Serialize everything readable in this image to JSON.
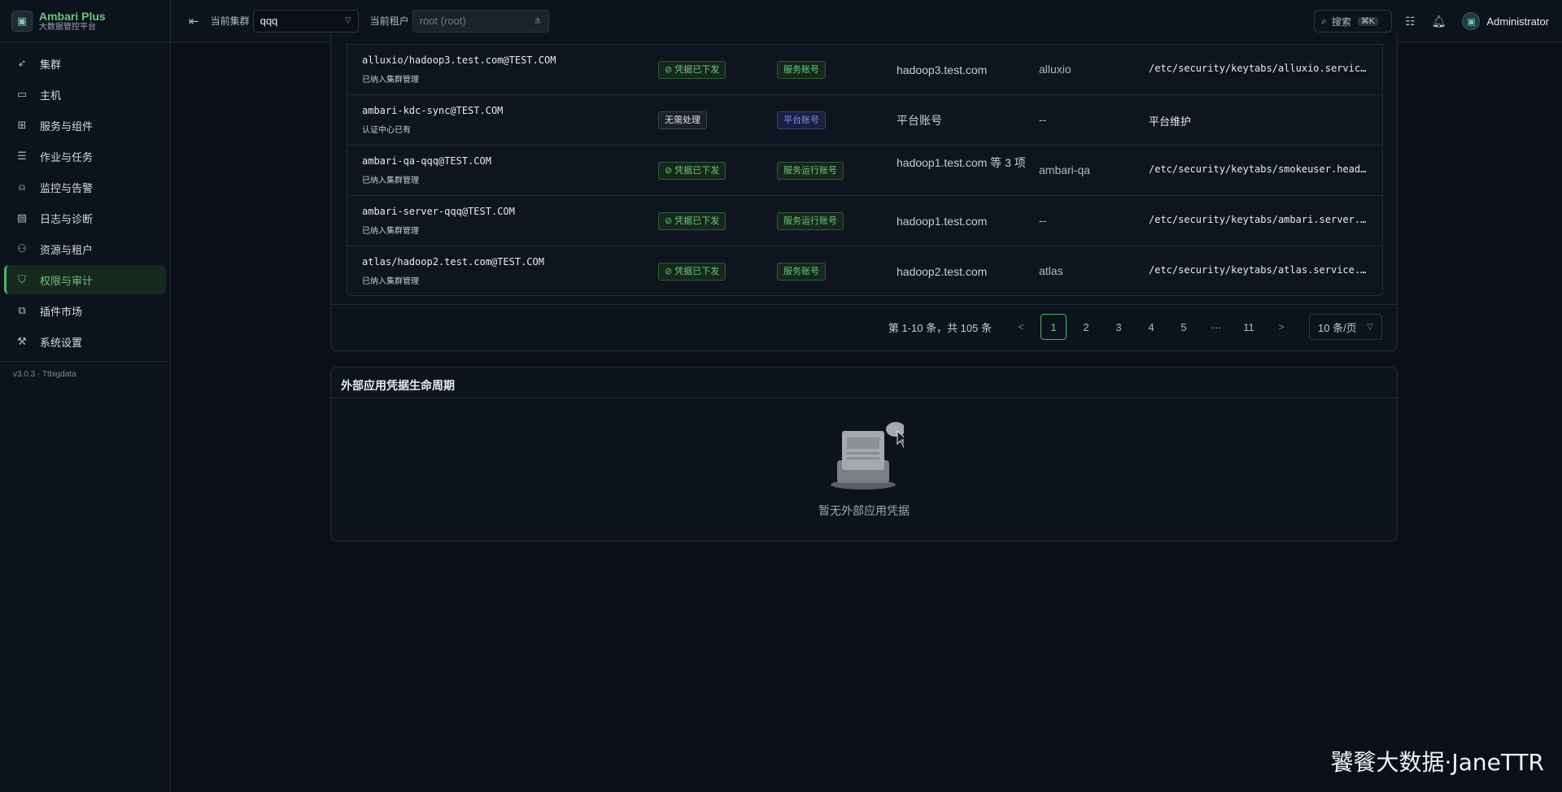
{
  "brand": {
    "name": "Ambari Plus",
    "subtitle": "大数据管控平台"
  },
  "sidebar": {
    "items": [
      {
        "label": "集群",
        "icon": "rocket-icon"
      },
      {
        "label": "主机",
        "icon": "monitor-icon"
      },
      {
        "label": "服务与组件",
        "icon": "grid-icon"
      },
      {
        "label": "作业与任务",
        "icon": "list-icon"
      },
      {
        "label": "监控与告警",
        "icon": "alarm-icon"
      },
      {
        "label": "日志与诊断",
        "icon": "document-icon"
      },
      {
        "label": "资源与租户",
        "icon": "users-icon"
      },
      {
        "label": "权限与审计",
        "icon": "shield-icon",
        "active": true
      },
      {
        "label": "插件市场",
        "icon": "plugin-icon"
      },
      {
        "label": "系统设置",
        "icon": "wrench-icon"
      }
    ],
    "version": "v3.0.3 · Ttbigdata"
  },
  "topbar": {
    "cluster_label": "当前集群",
    "cluster_value": "qqq",
    "tenant_label": "当前租户",
    "tenant_value": "root (root)",
    "search_label": "搜索",
    "search_shortcut": "⌘K",
    "username": "Administrator"
  },
  "table": {
    "rows": [
      {
        "principal": "alluxio/hadoop3.test.com@TEST.COM",
        "status": "已纳入集群管理",
        "dist": "凭据已下发",
        "dist_type": "ok",
        "acct": "服务账号",
        "acct_type": "svc",
        "host": "hadoop3.test.com",
        "user": "alluxio",
        "path": "/etc/security/keytabs/alluxio.service.keytab"
      },
      {
        "principal": "ambari-kdc-sync@TEST.COM",
        "status": "认证中心已有",
        "dist": "无需处理",
        "dist_type": "none",
        "acct": "平台账号",
        "acct_type": "plat",
        "host": "平台账号",
        "user": "--",
        "path": "平台维护"
      },
      {
        "principal": "ambari-qa-qqq@TEST.COM",
        "status": "已纳入集群管理",
        "dist": "凭据已下发",
        "dist_type": "ok",
        "acct": "服务运行账号",
        "acct_type": "svc",
        "host": "hadoop1.test.com 等 3 项",
        "user": "ambari-qa",
        "path": "/etc/security/keytabs/smokeuser.headless.keytab"
      },
      {
        "principal": "ambari-server-qqq@TEST.COM",
        "status": "已纳入集群管理",
        "dist": "凭据已下发",
        "dist_type": "ok",
        "acct": "服务运行账号",
        "acct_type": "svc",
        "host": "hadoop1.test.com",
        "user": "--",
        "path": "/etc/security/keytabs/ambari.server.keytab"
      },
      {
        "principal": "atlas/hadoop2.test.com@TEST.COM",
        "status": "已纳入集群管理",
        "dist": "凭据已下发",
        "dist_type": "ok",
        "acct": "服务账号",
        "acct_type": "svc",
        "host": "hadoop2.test.com",
        "user": "atlas",
        "path": "/etc/security/keytabs/atlas.service.keytab"
      }
    ]
  },
  "pagination": {
    "total_text": "第 1-10 条，共 105 条",
    "pages": [
      "1",
      "2",
      "3",
      "4",
      "5",
      "···",
      "11"
    ],
    "current": "1",
    "prev": "<",
    "next": ">",
    "page_size": "10 条/页"
  },
  "external": {
    "title": "外部应用凭据生命周期",
    "empty_text": "暂无外部应用凭据"
  },
  "watermark": "饕餮大数据·JaneTTR",
  "colors": {
    "accent": "#6cc47d",
    "background": "#0b1018",
    "platform_tag": "#7f90e8"
  }
}
